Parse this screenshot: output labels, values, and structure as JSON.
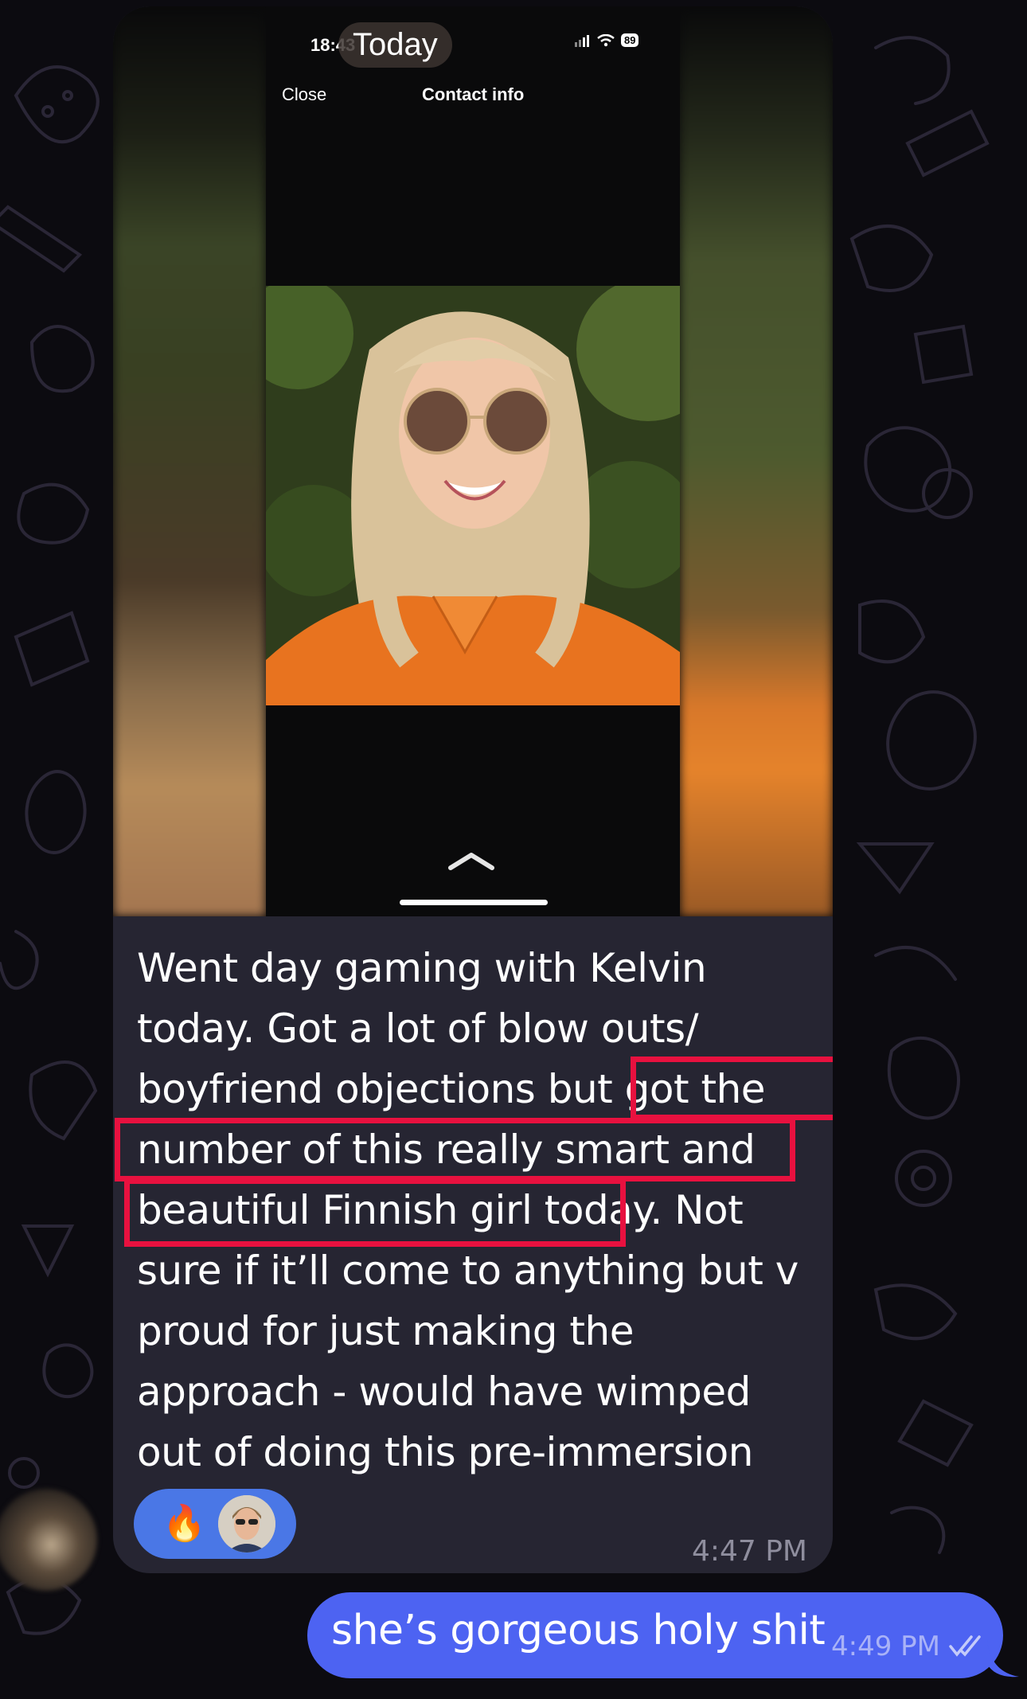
{
  "inner_screenshot": {
    "status_time": "18:43",
    "battery": "89",
    "date_badge": "Today",
    "close_label": "Close",
    "contact_info_label": "Contact info"
  },
  "incoming_message": {
    "lines": [
      "Went day gaming with Kelvin",
      "today. Got a lot of blow outs/",
      "boyfriend objections but got the",
      "number of this really smart and",
      "beautiful Finnish girl today. Not",
      "sure if it’ll come to anything but v",
      "proud for just making the",
      "approach - would have wimped",
      "out of doing this pre-immersion"
    ],
    "reaction_emoji": "🔥",
    "time": "4:47 PM"
  },
  "outgoing_message": {
    "text": "she’s gorgeous holy shit",
    "time": "4:49 PM"
  },
  "colors": {
    "outgoing_bubble": "#4d63f2",
    "incoming_bubble": "#262532",
    "highlight_box": "#e8113f",
    "reaction_pill": "#4a77e6"
  }
}
